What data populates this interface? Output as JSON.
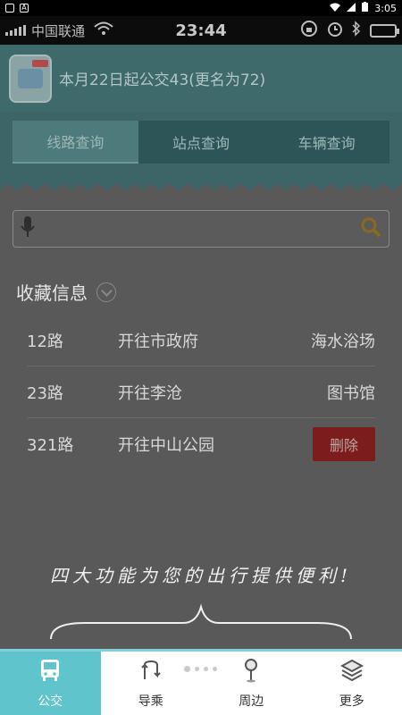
{
  "system_bar": {
    "time": "3:05",
    "notif_letter": "A"
  },
  "carrier_bar": {
    "carrier": "中国联通",
    "time": "23:44"
  },
  "header": {
    "news": "本月22日起公交43(更名为72)"
  },
  "tabs": [
    {
      "label": "线路查询"
    },
    {
      "label": "站点查询"
    },
    {
      "label": "车辆查询"
    }
  ],
  "search": {
    "placeholder": "",
    "value": ""
  },
  "favorites": {
    "title": "收藏信息",
    "rows": [
      {
        "route": "12路",
        "direction": "开往市政府",
        "dest": "海水浴场"
      },
      {
        "route": "23路",
        "direction": "开往李沧",
        "dest": "图书馆"
      },
      {
        "route": "321路",
        "direction": "开往中山公园",
        "action": "删除"
      }
    ]
  },
  "tagline": "四大功能为您的出行提供便利!",
  "bottom_nav": [
    {
      "label": "公交",
      "icon": "bus-icon"
    },
    {
      "label": "导乘",
      "icon": "transfer-icon"
    },
    {
      "label": "周边",
      "icon": "location-pin-icon"
    },
    {
      "label": "更多",
      "icon": "layers-icon"
    }
  ],
  "colors": {
    "accent": "#5fc4cc",
    "delete": "#7c1c1c",
    "header": "#3e6a6c"
  }
}
